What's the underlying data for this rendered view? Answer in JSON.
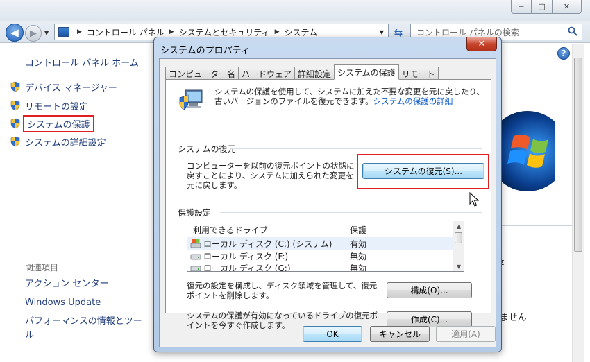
{
  "window": {
    "minimize": "─",
    "maximize": "□",
    "close": "✕"
  },
  "address": {
    "crumbs": [
      "コントロール パネル",
      "システムとセキュリティ",
      "システム"
    ]
  },
  "search": {
    "placeholder": "コントロール パネルの検索"
  },
  "sidebar": {
    "home": "コントロール パネル ホーム",
    "items": [
      {
        "label": "デバイス マネージャー"
      },
      {
        "label": "リモートの設定"
      },
      {
        "label": "システムの保護"
      },
      {
        "label": "システムの詳細設定"
      }
    ],
    "related_title": "関連項目",
    "related": [
      "アクション センター",
      "Windows Update",
      "パフォーマンスの情報とツール"
    ]
  },
  "right_fragments": {
    "text1": "z",
    "text2": "ません"
  },
  "dialog": {
    "title": "システムのプロパティ",
    "close_label": "✕",
    "tabs": [
      "コンピューター名",
      "ハードウェア",
      "詳細設定",
      "システムの保護",
      "リモート"
    ],
    "active_tab": 3,
    "description": "システムの保護を使用して、システムに加えた不要な変更を元に戻したり、古いバージョンのファイルを復元できます。",
    "description_link": "システムの保護の詳細",
    "restore_group_title": "システムの復元",
    "restore_desc": "コンピューターを以前の復元ポイントの状態に戻すことにより、システムに加えられた変更を元に戻します。",
    "restore_button": "システムの復元(S)...",
    "protection_group_title": "保護設定",
    "list_headers": {
      "drive": "利用できるドライブ",
      "protection": "保護"
    },
    "drives": [
      {
        "name": "ローカル ディスク (C:) (システム)",
        "protection": "有効"
      },
      {
        "name": "ローカル ディスク (F:)",
        "protection": "無効"
      },
      {
        "name": "ローカル ディスク (G:)",
        "protection": "無効"
      }
    ],
    "config_desc": "復元の設定を構成し、ディスク領域を管理して、復元ポイントを削除します。",
    "config_button": "構成(O)...",
    "create_desc": "システムの保護が有効になっているドライブの復元ポイントを今すぐ作成します。",
    "create_button": "作成(C)...",
    "ok_button": "OK",
    "cancel_button": "キャンセル",
    "apply_button": "適用(A)"
  },
  "colors": {
    "highlight": "#e02020",
    "link": "#1f3c7a",
    "dialog_frame": "#b3cae6"
  }
}
